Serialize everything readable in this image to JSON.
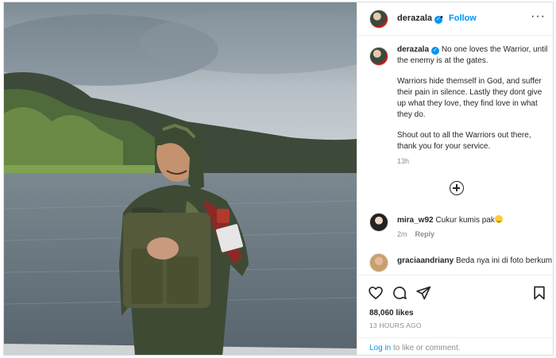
{
  "post": {
    "username": "derazala",
    "verified_glyph": "✓",
    "separator": "•",
    "follow_label": "Follow",
    "more_icon": "more-options-icon",
    "more_glyph": "···"
  },
  "caption": {
    "username": "derazala",
    "p1": "No one loves the Warrior, until the enemy is at the gates.",
    "p2": "Warriors hide themself in God, and suffer their pain in silence. Lastly they dont give up what they love, they find love in what they do.",
    "p3": "Shout out to all the Warriors out there, thank you for your service.",
    "time": "13h"
  },
  "load_more": {
    "icon": "plus-circle-icon"
  },
  "comments": [
    {
      "username": "mira_w92",
      "text": "Cukur kumis pak",
      "emoji": "smiling-face-emoji",
      "time": "2m",
      "reply_label": "Reply"
    },
    {
      "username": "graciaandriany",
      "text": "Beda nya ini di foto berkumis dan berjenggot, makanya",
      "time": "",
      "reply_label": ""
    }
  ],
  "actions": {
    "icons": [
      "heart-icon",
      "comment-icon",
      "share-icon",
      "bookmark-icon"
    ],
    "likes": "88,060 likes",
    "posted_ago": "13 HOURS AGO"
  },
  "login_bar": {
    "login_label": "Log in",
    "rest": " to like or comment."
  },
  "colors": {
    "link_blue": "#0095f6",
    "text": "#262626",
    "muted": "#8e8e8e",
    "border": "#dbdbdb"
  }
}
